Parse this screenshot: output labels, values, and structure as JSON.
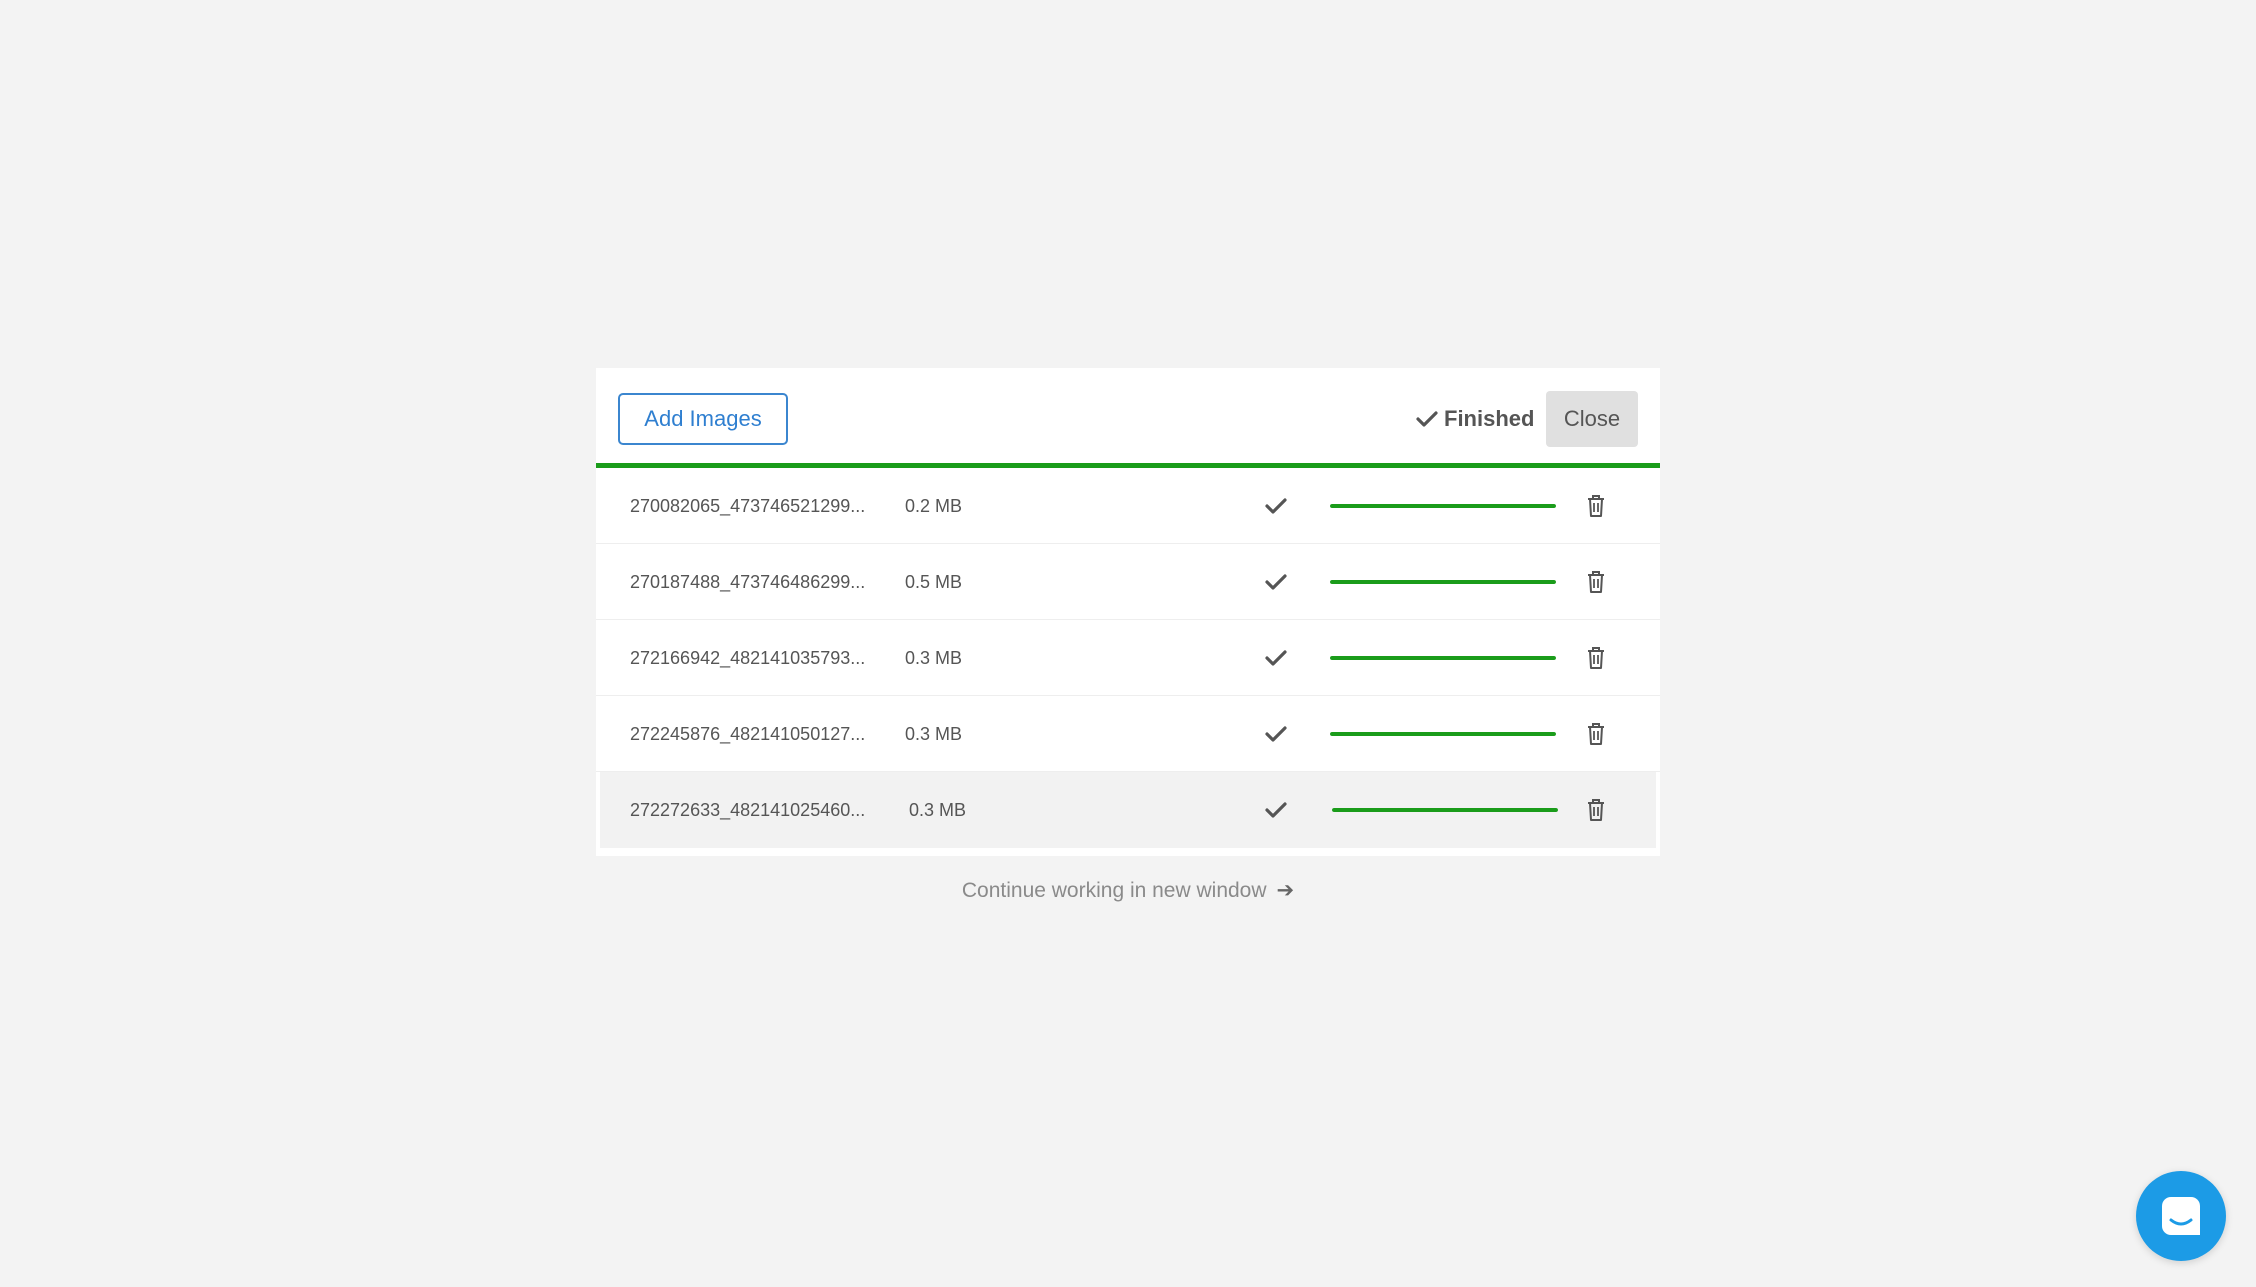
{
  "header": {
    "add_images_label": "Add Images",
    "status_label": "Finished",
    "close_label": "Close"
  },
  "files": [
    {
      "name": "270082065_473746521299...",
      "size": "0.2 MB",
      "progress": 100
    },
    {
      "name": "270187488_473746486299...",
      "size": "0.5 MB",
      "progress": 100
    },
    {
      "name": "272166942_482141035793...",
      "size": "0.3 MB",
      "progress": 100
    },
    {
      "name": "272245876_482141050127...",
      "size": "0.3 MB",
      "progress": 100
    },
    {
      "name": "272272633_482141025460...",
      "size": "0.3 MB",
      "progress": 100
    }
  ],
  "footer": {
    "continue_label": "Continue working in new window",
    "arrow": "➔"
  },
  "colors": {
    "accent": "#1a9c1a",
    "button_blue": "#2f7fd0",
    "chat_blue": "#1c9be6"
  },
  "icons": {
    "status": "check-icon",
    "row_status": "check-icon",
    "delete": "trash-icon",
    "chat": "chat-icon"
  }
}
